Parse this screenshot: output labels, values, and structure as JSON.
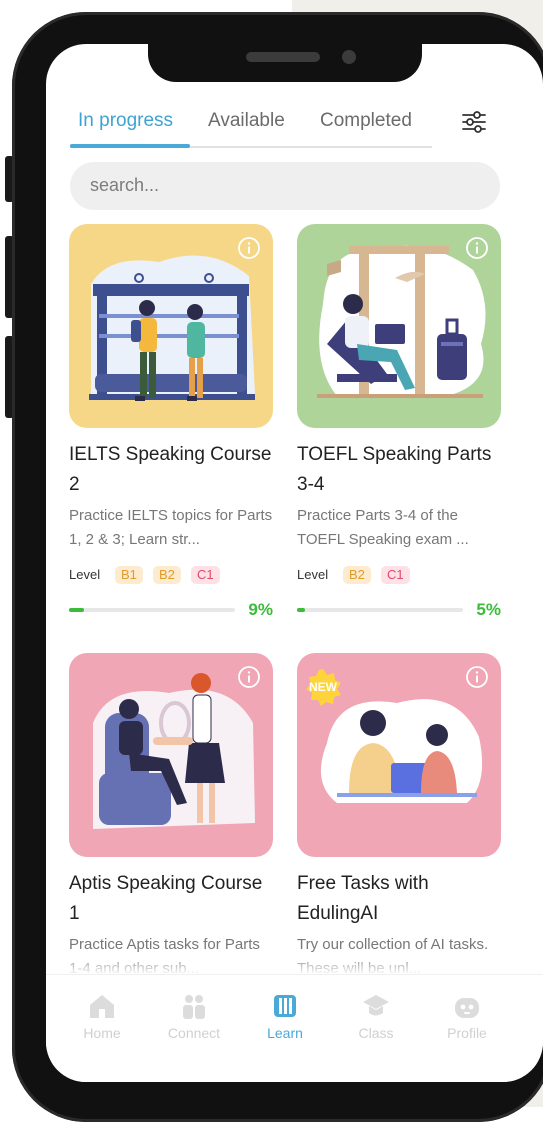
{
  "tabs": [
    {
      "label": "In progress",
      "active": true
    },
    {
      "label": "Available",
      "active": false
    },
    {
      "label": "Completed",
      "active": false
    }
  ],
  "search": {
    "placeholder": "search..."
  },
  "courses": [
    {
      "title": "IELTS Speaking Course 2",
      "description": "Practice IELTS topics for Parts 1, 2 & 3; Learn str...",
      "level_label": "Level",
      "levels": [
        "B1",
        "B2",
        "C1"
      ],
      "progress_percent": 9,
      "progress_text": "9%",
      "thumb_color": "#f6d787",
      "icon": "info-icon"
    },
    {
      "title": "TOEFL Speaking Parts 3-4",
      "description": "Practice Parts 3-4 of the TOEFL Speaking exam ...",
      "level_label": "Level",
      "levels": [
        "B2",
        "C1"
      ],
      "progress_percent": 5,
      "progress_text": "5%",
      "thumb_color": "#aed49a",
      "icon": "info-icon"
    },
    {
      "title": "Aptis Speaking Course 1",
      "description": "Practice Aptis tasks for Parts 1-4 and other sub...",
      "thumb_color": "#f0a6b4",
      "icon": "info-icon"
    },
    {
      "title": "Free Tasks with EdulingAI",
      "description": "Try our collection of AI tasks. These will be unl...",
      "badge": "NEW",
      "thumb_color": "#f0a6b4",
      "icon": "info-icon"
    }
  ],
  "nav": [
    {
      "label": "Home",
      "icon": "home-icon",
      "active": false
    },
    {
      "label": "Connect",
      "icon": "people-icon",
      "active": false
    },
    {
      "label": "Learn",
      "icon": "book-icon",
      "active": true
    },
    {
      "label": "Class",
      "icon": "graduation-cap-icon",
      "active": false
    },
    {
      "label": "Profile",
      "icon": "robot-face-icon",
      "active": false
    }
  ],
  "colors": {
    "accent": "#4aa9d6",
    "progress": "#3dbb3b",
    "level_b": "#e29a2a",
    "level_c": "#e2496b"
  }
}
